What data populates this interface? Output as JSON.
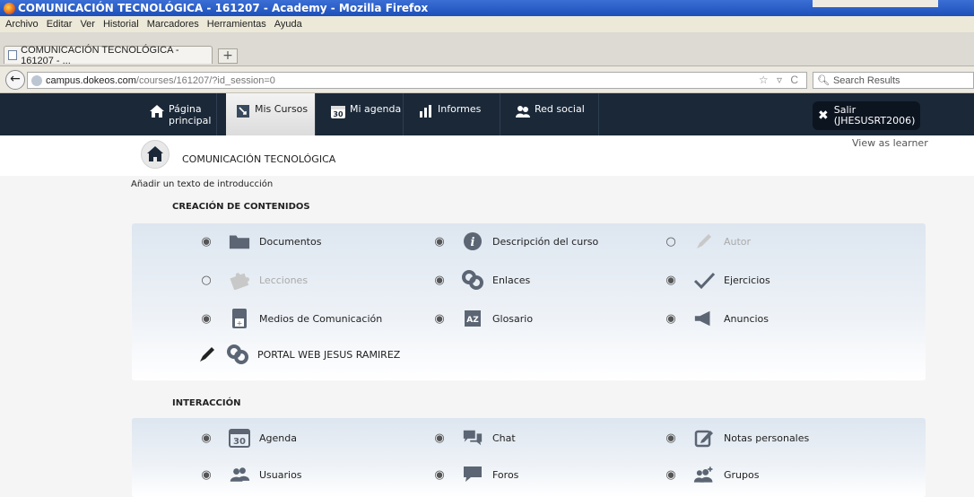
{
  "window": {
    "title": "COMUNICACIÓN TECNOLÓGICA - 161207 - Academy - Mozilla Firefox"
  },
  "menu": [
    "Archivo",
    "Editar",
    "Ver",
    "Historial",
    "Marcadores",
    "Herramientas",
    "Ayuda"
  ],
  "tab": {
    "label": "COMUNICACIÓN TECNOLÓGICA - 161207 - ...",
    "new_tab": "+"
  },
  "url": {
    "domain": "campus.dokeos.com",
    "path": "/courses/161207/?id_session=0"
  },
  "search": {
    "placeholder": "Search Results"
  },
  "sitenav": {
    "home_line1": "Página",
    "home_line2": "principal",
    "courses": "Mis Cursos",
    "agenda": "Mi agenda",
    "reports": "Informes",
    "social": "Red social",
    "logout_line1": "Salir",
    "logout_line2": "(JHESUSRT2006)"
  },
  "course": {
    "title": "COMUNICACIÓN TECNOLÓGICA",
    "view_as": "View as learner",
    "intro": "Añadir un texto de introducción"
  },
  "sections": {
    "content_title": "CREACIÓN DE CONTENIDOS",
    "interaction_title": "INTERACCIÓN"
  },
  "tools": {
    "documentos": "Documentos",
    "descripcion": "Descripción del curso",
    "autor": "Autor",
    "lecciones": "Lecciones",
    "enlaces": "Enlaces",
    "ejercicios": "Ejercicios",
    "medios": "Medios de Comunicación",
    "glosario": "Glosario",
    "anuncios": "Anuncios",
    "portal": "PORTAL WEB JESUS RAMIREZ",
    "agenda": "Agenda",
    "chat": "Chat",
    "notas": "Notas personales",
    "usuarios": "Usuarios",
    "foros": "Foros",
    "grupos": "Grupos"
  },
  "icons": {
    "agenda_day": "30",
    "glossary": "AZ"
  },
  "colors": {
    "nav_bg": "#1a2838",
    "panel_top": "#dde6f0",
    "icon_gray": "#5b6573"
  }
}
